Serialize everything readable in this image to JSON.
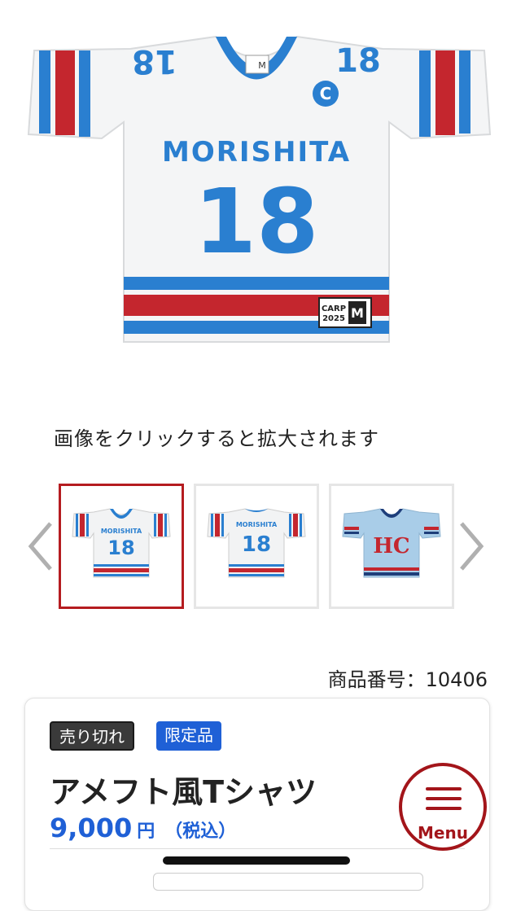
{
  "main_image": {
    "jersey": {
      "name": "MORISHITA",
      "number": "18",
      "sleeve_number": "18",
      "tag_line1": "CARP",
      "tag_line2": "2025",
      "tag_size": "M",
      "neck_size": "M"
    }
  },
  "hint_text": "画像をクリックすると拡大されます",
  "thumbnails": [
    {
      "label": "jersey-front-white",
      "name": "MORISHITA",
      "number": "18",
      "selected": true
    },
    {
      "label": "jersey-back-white",
      "name": "MORISHITA",
      "number": "18",
      "selected": false
    },
    {
      "label": "jersey-light-blue",
      "name": "HC",
      "number": "",
      "selected": false
    }
  ],
  "product_number": "商品番号：10406",
  "card": {
    "badges": {
      "sold_out": "売り切れ",
      "limited": "限定品"
    },
    "title": "アメフト風Tシャツ",
    "price": {
      "amount": "9,000",
      "currency": "円",
      "tax": "（税込）"
    }
  },
  "menu": {
    "label": "Menu"
  },
  "colors": {
    "accent_red": "#b51c20",
    "menu_red": "#a3151a",
    "brand_blue": "#1f60d6",
    "jersey_blue": "#2a7fd0",
    "jersey_red": "#c4262e"
  },
  "icons": {
    "prev": "chevron-left-icon",
    "next": "chevron-right-icon",
    "menu": "hamburger-icon"
  }
}
